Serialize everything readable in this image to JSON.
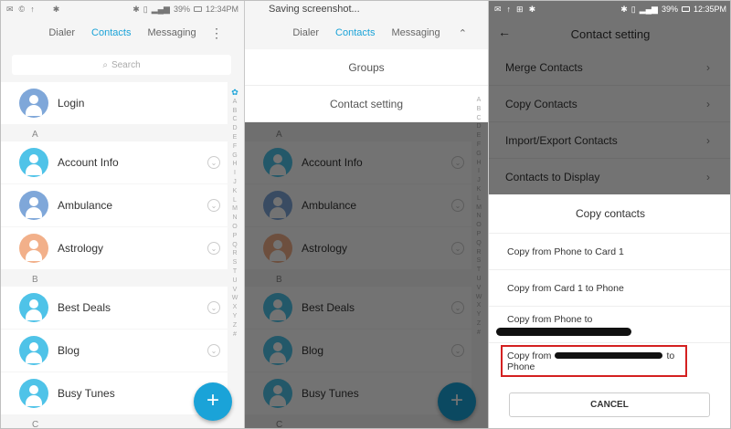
{
  "panel1": {
    "status": {
      "signal": "39%",
      "time": "12:34PM"
    },
    "tabs": [
      {
        "label": "Dialer",
        "active": false
      },
      {
        "label": "Contacts",
        "active": true
      },
      {
        "label": "Messaging",
        "active": false
      }
    ],
    "search_placeholder": "Search",
    "login_label": "Login",
    "sections": [
      {
        "letter": "A",
        "items": [
          {
            "label": "Account Info",
            "color": "#4fc3e8"
          },
          {
            "label": "Ambulance",
            "color": "#7fa7d9"
          },
          {
            "label": "Astrology",
            "color": "#f2b08a"
          }
        ]
      },
      {
        "letter": "B",
        "items": [
          {
            "label": "Best Deals",
            "color": "#4fc3e8"
          },
          {
            "label": "Blog",
            "color": "#4fc3e8"
          },
          {
            "label": "Busy Tunes",
            "color": "#4fc3e8"
          }
        ]
      },
      {
        "letter": "C",
        "items": []
      }
    ],
    "alphabet": [
      "A",
      "B",
      "C",
      "D",
      "E",
      "F",
      "G",
      "H",
      "I",
      "J",
      "K",
      "L",
      "M",
      "N",
      "O",
      "P",
      "Q",
      "R",
      "S",
      "T",
      "U",
      "V",
      "W",
      "X",
      "Y",
      "Z",
      "#"
    ],
    "fab_label": "+"
  },
  "panel2": {
    "status_text": "Saving screenshot...",
    "tabs": [
      {
        "label": "Dialer",
        "active": false
      },
      {
        "label": "Contacts",
        "active": true
      },
      {
        "label": "Messaging",
        "active": false
      }
    ],
    "menu": [
      "Groups",
      "Contact setting"
    ]
  },
  "panel3": {
    "status": {
      "signal": "39%",
      "time": "12:35PM"
    },
    "title": "Contact setting",
    "settings": [
      "Merge Contacts",
      "Copy Contacts",
      "Import/Export Contacts",
      "Contacts to Display"
    ],
    "dialog": {
      "title": "Copy contacts",
      "options": [
        "Copy from Phone to Card 1",
        "Copy from Card 1 to Phone",
        "Copy from Phone to",
        "Copy from",
        "to",
        "Phone"
      ],
      "cancel": "CANCEL"
    }
  }
}
